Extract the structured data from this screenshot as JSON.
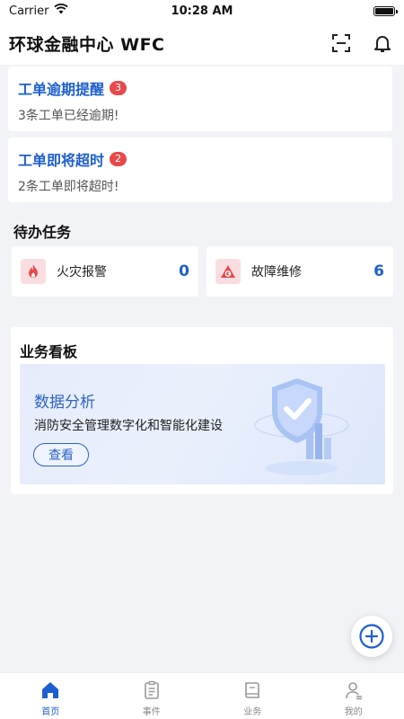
{
  "status_bar": {
    "carrier": "Carrier",
    "time": "10:28 AM"
  },
  "header": {
    "title": "环球金融中心 WFC",
    "scan_icon": "scan-icon",
    "bell_icon": "bell-icon"
  },
  "alerts": [
    {
      "title": "工单逾期提醒",
      "badge": "3",
      "desc": "3条工单已经逾期!"
    },
    {
      "title": "工单即将超时",
      "badge": "2",
      "desc": "2条工单即将超时!"
    }
  ],
  "todo": {
    "title": "待办任务",
    "items": [
      {
        "label": "火灾报警",
        "count": "0",
        "icon": "fire-icon"
      },
      {
        "label": "故障维修",
        "count": "6",
        "icon": "repair-icon"
      }
    ]
  },
  "board": {
    "title": "业务看板",
    "banner_title": "数据分析",
    "banner_sub": "消防安全管理数字化和智能化建设",
    "button": "查看"
  },
  "tabbar": {
    "items": [
      {
        "label": "首页",
        "icon": "home-icon",
        "active": true
      },
      {
        "label": "事件",
        "icon": "clipboard-icon",
        "active": false
      },
      {
        "label": "业务",
        "icon": "book-icon",
        "active": false
      },
      {
        "label": "我的",
        "icon": "user-icon",
        "active": false
      }
    ]
  },
  "colors": {
    "accent": "#1d5fd0",
    "badge": "#e8494a",
    "background": "#f2f3f6"
  }
}
